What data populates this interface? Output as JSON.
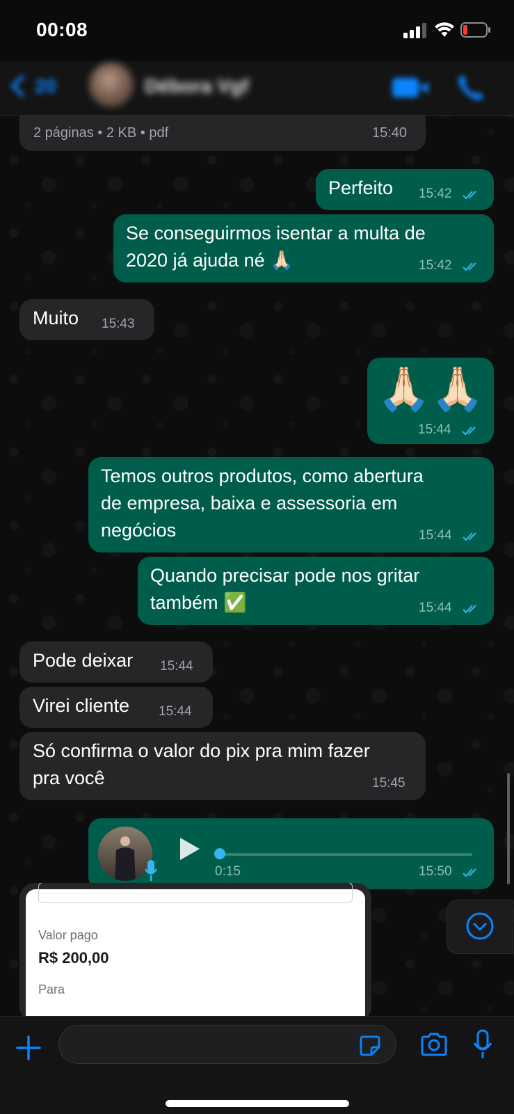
{
  "status_bar": {
    "time": "00:08"
  },
  "header": {
    "back_count": "20",
    "contact_name": "Débora Vgf"
  },
  "colors": {
    "incoming_bubble": "#262628",
    "outgoing_bubble": "#005c4b",
    "accent": "#0a84ff",
    "read_ticks": "#34b7f1"
  },
  "messages": {
    "doc": {
      "meta": "2 páginas • 2 KB • pdf",
      "time": "15:40"
    },
    "m1": {
      "text": "Perfeito",
      "time": "15:42"
    },
    "m2": {
      "line1": "Se conseguirmos isentar a multa de",
      "line2": "2020 já ajuda né 🙏🏻",
      "time": "15:42"
    },
    "m3": {
      "text": "Muito",
      "time": "15:43"
    },
    "m4": {
      "text": "🙏🏻🙏🏻",
      "time": "15:44"
    },
    "m5": {
      "line1": "Temos outros produtos, como abertura",
      "line2": "de empresa, baixa e assessoria em",
      "line3": "negócios",
      "time": "15:44"
    },
    "m6": {
      "line1": "Quando precisar pode nos gritar",
      "line2": "também ✅",
      "time": "15:44"
    },
    "m7": {
      "text": "Pode deixar",
      "time": "15:44"
    },
    "m8": {
      "text": "Virei cliente",
      "time": "15:44"
    },
    "m9": {
      "line1": "Só confirma o valor do pix pra mim fazer",
      "line2": "pra você",
      "time": "15:45"
    },
    "voice": {
      "duration": "0:15",
      "time": "15:50",
      "progress": 0
    },
    "image": {
      "label_paid": "Valor pago",
      "amount": "R$ 200,00",
      "label_to": "Para"
    }
  },
  "composer": {
    "placeholder": ""
  }
}
